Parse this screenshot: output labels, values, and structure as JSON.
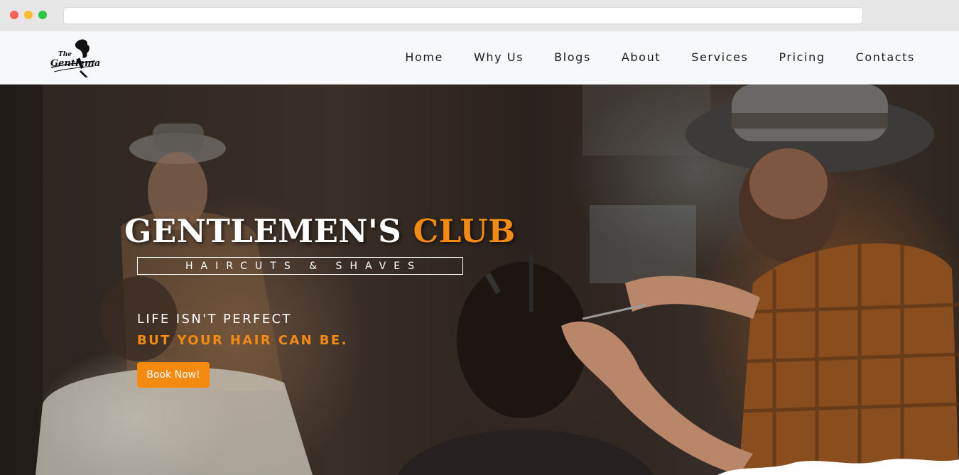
{
  "browser": {
    "window_controls": [
      "close",
      "minimize",
      "maximize"
    ],
    "address_bar_value": ""
  },
  "site": {
    "logo": {
      "text_top": "The",
      "text_main": "Gentleman",
      "icon": "gentleman-logo-icon"
    },
    "nav": {
      "items": [
        {
          "label": "Home"
        },
        {
          "label": "Why Us"
        },
        {
          "label": "Blogs"
        },
        {
          "label": "About"
        },
        {
          "label": "Services"
        },
        {
          "label": "Pricing"
        },
        {
          "label": "Contacts"
        }
      ]
    }
  },
  "hero": {
    "title_main": "GENTLEMEN'S ",
    "title_accent": "CLUB",
    "tagline": "HAIRCUTS & SHAVES",
    "line1": "LIFE ISN'T PERFECT",
    "line2": "BUT YOUR HAIR CAN BE.",
    "cta_label": "Book Now!",
    "background_image": "barbershop-photo"
  },
  "colors": {
    "accent": "#f58a11",
    "nav_bg": "#f7f8fa",
    "nav_text": "#1b1b1b",
    "hero_text": "#ffffff"
  }
}
